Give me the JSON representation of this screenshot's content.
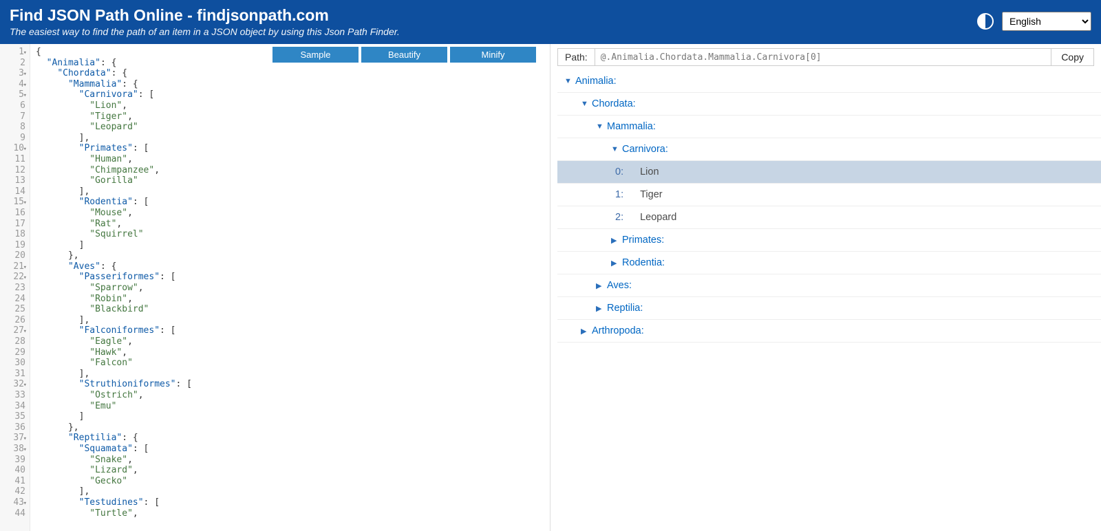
{
  "header": {
    "title": "Find JSON Path Online - findjsonpath.com",
    "subtitle": "The easiest way to find the path of an item in a JSON object by using this Json Path Finder.",
    "language": "English"
  },
  "editor_buttons": {
    "sample": "Sample",
    "beautify": "Beautify",
    "minify": "Minify"
  },
  "code_lines": [
    {
      "n": 1,
      "fold": true,
      "tokens": [
        {
          "c": "p",
          "t": "{"
        }
      ]
    },
    {
      "n": 2,
      "tokens": [
        {
          "c": "p",
          "t": "  "
        },
        {
          "c": "k",
          "t": "\"Animalia\""
        },
        {
          "c": "p",
          "t": ": {"
        }
      ]
    },
    {
      "n": 3,
      "fold": true,
      "tokens": [
        {
          "c": "p",
          "t": "    "
        },
        {
          "c": "k",
          "t": "\"Chordata\""
        },
        {
          "c": "p",
          "t": ": {"
        }
      ]
    },
    {
      "n": 4,
      "fold": true,
      "tokens": [
        {
          "c": "p",
          "t": "      "
        },
        {
          "c": "k",
          "t": "\"Mammalia\""
        },
        {
          "c": "p",
          "t": ": {"
        }
      ]
    },
    {
      "n": 5,
      "fold": true,
      "tokens": [
        {
          "c": "p",
          "t": "        "
        },
        {
          "c": "k",
          "t": "\"Carnivora\""
        },
        {
          "c": "p",
          "t": ": ["
        }
      ]
    },
    {
      "n": 6,
      "tokens": [
        {
          "c": "p",
          "t": "          "
        },
        {
          "c": "s",
          "t": "\"Lion\""
        },
        {
          "c": "p",
          "t": ","
        }
      ]
    },
    {
      "n": 7,
      "tokens": [
        {
          "c": "p",
          "t": "          "
        },
        {
          "c": "s",
          "t": "\"Tiger\""
        },
        {
          "c": "p",
          "t": ","
        }
      ]
    },
    {
      "n": 8,
      "tokens": [
        {
          "c": "p",
          "t": "          "
        },
        {
          "c": "s",
          "t": "\"Leopard\""
        }
      ]
    },
    {
      "n": 9,
      "tokens": [
        {
          "c": "p",
          "t": "        ],"
        }
      ]
    },
    {
      "n": 10,
      "fold": true,
      "tokens": [
        {
          "c": "p",
          "t": "        "
        },
        {
          "c": "k",
          "t": "\"Primates\""
        },
        {
          "c": "p",
          "t": ": ["
        }
      ]
    },
    {
      "n": 11,
      "tokens": [
        {
          "c": "p",
          "t": "          "
        },
        {
          "c": "s",
          "t": "\"Human\""
        },
        {
          "c": "p",
          "t": ","
        }
      ]
    },
    {
      "n": 12,
      "tokens": [
        {
          "c": "p",
          "t": "          "
        },
        {
          "c": "s",
          "t": "\"Chimpanzee\""
        },
        {
          "c": "p",
          "t": ","
        }
      ]
    },
    {
      "n": 13,
      "tokens": [
        {
          "c": "p",
          "t": "          "
        },
        {
          "c": "s",
          "t": "\"Gorilla\""
        }
      ]
    },
    {
      "n": 14,
      "tokens": [
        {
          "c": "p",
          "t": "        ],"
        }
      ]
    },
    {
      "n": 15,
      "fold": true,
      "tokens": [
        {
          "c": "p",
          "t": "        "
        },
        {
          "c": "k",
          "t": "\"Rodentia\""
        },
        {
          "c": "p",
          "t": ": ["
        }
      ]
    },
    {
      "n": 16,
      "tokens": [
        {
          "c": "p",
          "t": "          "
        },
        {
          "c": "s",
          "t": "\"Mouse\""
        },
        {
          "c": "p",
          "t": ","
        }
      ]
    },
    {
      "n": 17,
      "tokens": [
        {
          "c": "p",
          "t": "          "
        },
        {
          "c": "s",
          "t": "\"Rat\""
        },
        {
          "c": "p",
          "t": ","
        }
      ]
    },
    {
      "n": 18,
      "tokens": [
        {
          "c": "p",
          "t": "          "
        },
        {
          "c": "s",
          "t": "\"Squirrel\""
        }
      ]
    },
    {
      "n": 19,
      "tokens": [
        {
          "c": "p",
          "t": "        ]"
        }
      ]
    },
    {
      "n": 20,
      "tokens": [
        {
          "c": "p",
          "t": "      },"
        }
      ]
    },
    {
      "n": 21,
      "fold": true,
      "tokens": [
        {
          "c": "p",
          "t": "      "
        },
        {
          "c": "k",
          "t": "\"Aves\""
        },
        {
          "c": "p",
          "t": ": {"
        }
      ]
    },
    {
      "n": 22,
      "fold": true,
      "tokens": [
        {
          "c": "p",
          "t": "        "
        },
        {
          "c": "k",
          "t": "\"Passeriformes\""
        },
        {
          "c": "p",
          "t": ": ["
        }
      ]
    },
    {
      "n": 23,
      "tokens": [
        {
          "c": "p",
          "t": "          "
        },
        {
          "c": "s",
          "t": "\"Sparrow\""
        },
        {
          "c": "p",
          "t": ","
        }
      ]
    },
    {
      "n": 24,
      "tokens": [
        {
          "c": "p",
          "t": "          "
        },
        {
          "c": "s",
          "t": "\"Robin\""
        },
        {
          "c": "p",
          "t": ","
        }
      ]
    },
    {
      "n": 25,
      "tokens": [
        {
          "c": "p",
          "t": "          "
        },
        {
          "c": "s",
          "t": "\"Blackbird\""
        }
      ]
    },
    {
      "n": 26,
      "tokens": [
        {
          "c": "p",
          "t": "        ],"
        }
      ]
    },
    {
      "n": 27,
      "fold": true,
      "tokens": [
        {
          "c": "p",
          "t": "        "
        },
        {
          "c": "k",
          "t": "\"Falconiformes\""
        },
        {
          "c": "p",
          "t": ": ["
        }
      ]
    },
    {
      "n": 28,
      "tokens": [
        {
          "c": "p",
          "t": "          "
        },
        {
          "c": "s",
          "t": "\"Eagle\""
        },
        {
          "c": "p",
          "t": ","
        }
      ]
    },
    {
      "n": 29,
      "tokens": [
        {
          "c": "p",
          "t": "          "
        },
        {
          "c": "s",
          "t": "\"Hawk\""
        },
        {
          "c": "p",
          "t": ","
        }
      ]
    },
    {
      "n": 30,
      "tokens": [
        {
          "c": "p",
          "t": "          "
        },
        {
          "c": "s",
          "t": "\"Falcon\""
        }
      ]
    },
    {
      "n": 31,
      "tokens": [
        {
          "c": "p",
          "t": "        ],"
        }
      ]
    },
    {
      "n": 32,
      "fold": true,
      "tokens": [
        {
          "c": "p",
          "t": "        "
        },
        {
          "c": "k",
          "t": "\"Struthioniformes\""
        },
        {
          "c": "p",
          "t": ": ["
        }
      ]
    },
    {
      "n": 33,
      "tokens": [
        {
          "c": "p",
          "t": "          "
        },
        {
          "c": "s",
          "t": "\"Ostrich\""
        },
        {
          "c": "p",
          "t": ","
        }
      ]
    },
    {
      "n": 34,
      "tokens": [
        {
          "c": "p",
          "t": "          "
        },
        {
          "c": "s",
          "t": "\"Emu\""
        }
      ]
    },
    {
      "n": 35,
      "tokens": [
        {
          "c": "p",
          "t": "        ]"
        }
      ]
    },
    {
      "n": 36,
      "tokens": [
        {
          "c": "p",
          "t": "      },"
        }
      ]
    },
    {
      "n": 37,
      "fold": true,
      "tokens": [
        {
          "c": "p",
          "t": "      "
        },
        {
          "c": "k",
          "t": "\"Reptilia\""
        },
        {
          "c": "p",
          "t": ": {"
        }
      ]
    },
    {
      "n": 38,
      "fold": true,
      "tokens": [
        {
          "c": "p",
          "t": "        "
        },
        {
          "c": "k",
          "t": "\"Squamata\""
        },
        {
          "c": "p",
          "t": ": ["
        }
      ]
    },
    {
      "n": 39,
      "tokens": [
        {
          "c": "p",
          "t": "          "
        },
        {
          "c": "s",
          "t": "\"Snake\""
        },
        {
          "c": "p",
          "t": ","
        }
      ]
    },
    {
      "n": 40,
      "tokens": [
        {
          "c": "p",
          "t": "          "
        },
        {
          "c": "s",
          "t": "\"Lizard\""
        },
        {
          "c": "p",
          "t": ","
        }
      ]
    },
    {
      "n": 41,
      "tokens": [
        {
          "c": "p",
          "t": "          "
        },
        {
          "c": "s",
          "t": "\"Gecko\""
        }
      ]
    },
    {
      "n": 42,
      "tokens": [
        {
          "c": "p",
          "t": "        ],"
        }
      ]
    },
    {
      "n": 43,
      "fold": true,
      "tokens": [
        {
          "c": "p",
          "t": "        "
        },
        {
          "c": "k",
          "t": "\"Testudines\""
        },
        {
          "c": "p",
          "t": ": ["
        }
      ]
    },
    {
      "n": 44,
      "tokens": [
        {
          "c": "p",
          "t": "          "
        },
        {
          "c": "s",
          "t": "\"Turtle\""
        },
        {
          "c": "p",
          "t": ","
        }
      ]
    }
  ],
  "path": {
    "label": "Path:",
    "value": "@.Animalia.Chordata.Mammalia.Carnivora[0]",
    "copy": "Copy"
  },
  "tree": [
    {
      "indent": 0,
      "tri": "open",
      "key": "Animalia:",
      "sel": false
    },
    {
      "indent": 1,
      "tri": "open",
      "key": "Chordata:",
      "sel": false
    },
    {
      "indent": 2,
      "tri": "open",
      "key": "Mammalia:",
      "sel": false
    },
    {
      "indent": 3,
      "tri": "open",
      "key": "Carnivora:",
      "sel": false
    },
    {
      "indent": 4,
      "idx": "0:",
      "val": "Lion",
      "sel": true
    },
    {
      "indent": 4,
      "idx": "1:",
      "val": "Tiger",
      "sel": false
    },
    {
      "indent": 4,
      "idx": "2:",
      "val": "Leopard",
      "sel": false
    },
    {
      "indent": 3,
      "tri": "closed",
      "key": "Primates:",
      "sel": false
    },
    {
      "indent": 3,
      "tri": "closed",
      "key": "Rodentia:",
      "sel": false
    },
    {
      "indent": 2,
      "tri": "closed",
      "key": "Aves:",
      "sel": false
    },
    {
      "indent": 2,
      "tri": "closed",
      "key": "Reptilia:",
      "sel": false
    },
    {
      "indent": 1,
      "tri": "closed",
      "key": "Arthropoda:",
      "sel": false
    }
  ]
}
